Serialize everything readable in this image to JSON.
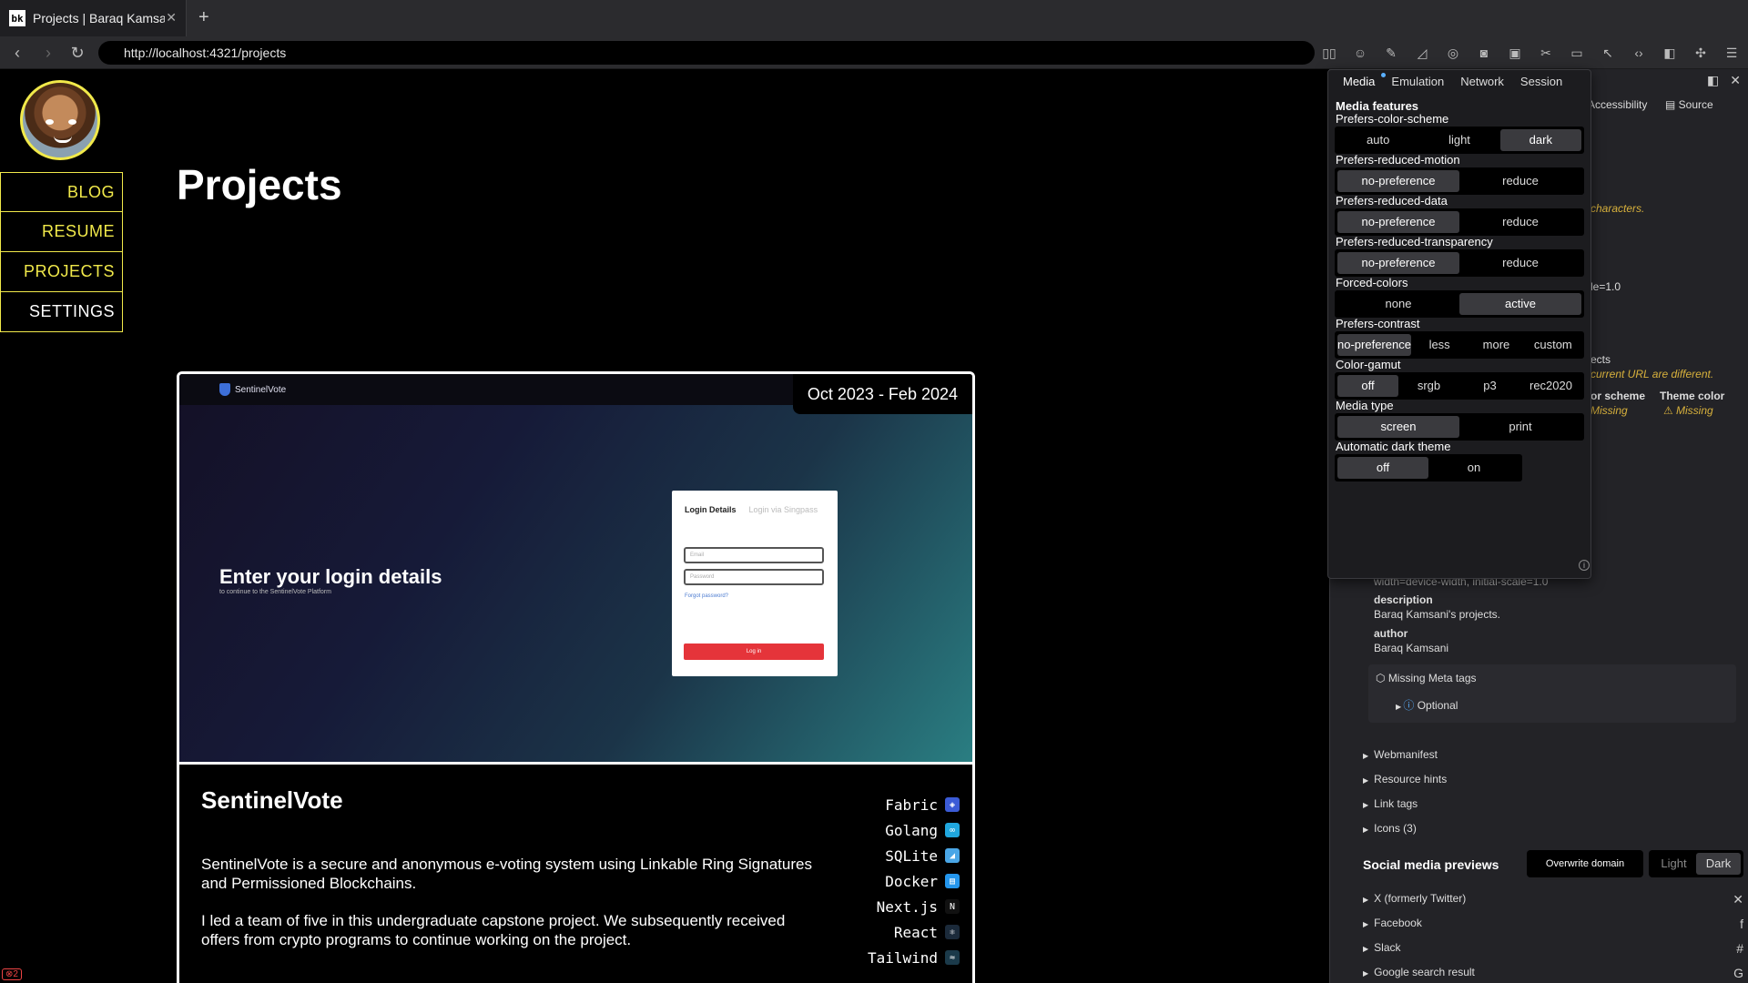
{
  "browser": {
    "tab_title": "Projects | Baraq Kamsani",
    "tab_close": "✕",
    "new_tab": "+",
    "url": "http://localhost:4321/projects"
  },
  "site": {
    "nav": [
      "BLOG",
      "RESUME",
      "PROJECTS",
      "SETTINGS"
    ],
    "page_title": "Projects",
    "project": {
      "date_range": "Oct 2023 - Feb 2024",
      "title": "SentinelVote",
      "desc_1": "SentinelVote is a secure and anonymous e-voting system using Linkable Ring Signatures and Permissioned Blockchains.",
      "desc_2": "I led a team of five in this undergraduate capstone project. We subsequently received offers from crypto programs to continue working on the project.",
      "screenshot": {
        "logo": "SentinelVote",
        "heading": "Enter your login details",
        "subheading": "to continue to the SentinelVote Platform",
        "tab_active": "Login Details",
        "tab_inactive": "Login via Singpass",
        "email_placeholder": "Email",
        "password_placeholder": "Password",
        "forgot": "Forgot password?",
        "login_button": "Log in"
      },
      "stack": [
        {
          "name": "Fabric",
          "icon": "fabric-icon",
          "color": "#3b5bd6",
          "glyph": "◈"
        },
        {
          "name": "Golang",
          "icon": "golang-icon",
          "color": "#20a7de",
          "glyph": "∞"
        },
        {
          "name": "SQLite",
          "icon": "sqlite-icon",
          "color": "#4aa6e6",
          "glyph": "◢"
        },
        {
          "name": "Docker",
          "icon": "docker-icon",
          "color": "#2496ed",
          "glyph": "▤"
        },
        {
          "name": "Next.js",
          "icon": "nextjs-icon",
          "color": "#111111",
          "glyph": "N"
        },
        {
          "name": "React",
          "icon": "react-icon",
          "color": "#1b2a3a",
          "glyph": "⚛"
        },
        {
          "name": "Tailwind",
          "icon": "tailwind-icon",
          "color": "#1b3a4a",
          "glyph": "≈"
        }
      ]
    }
  },
  "popover": {
    "tabs": [
      "Media",
      "Emulation",
      "Network",
      "Session"
    ],
    "title": "Media features",
    "features": [
      {
        "label": "Prefers-color-scheme",
        "options": [
          "auto",
          "light",
          "dark"
        ],
        "selected": 2
      },
      {
        "label": "Prefers-reduced-motion",
        "options": [
          "no-preference",
          "reduce"
        ],
        "selected": 0
      },
      {
        "label": "Prefers-reduced-data",
        "options": [
          "no-preference",
          "reduce"
        ],
        "selected": 0
      },
      {
        "label": "Prefers-reduced-transparency",
        "options": [
          "no-preference",
          "reduce"
        ],
        "selected": 0
      },
      {
        "label": "Forced-colors",
        "options": [
          "none",
          "active"
        ],
        "selected": 1
      },
      {
        "label": "Prefers-contrast",
        "options": [
          "no-preference",
          "less",
          "more",
          "custom"
        ],
        "selected": 0
      },
      {
        "label": "Color-gamut",
        "options": [
          "off",
          "srgb",
          "p3",
          "rec2020"
        ],
        "selected": 0
      },
      {
        "label": "Media type",
        "options": [
          "screen",
          "print"
        ],
        "selected": 0
      },
      {
        "label": "Automatic dark theme",
        "options": [
          "off",
          "on"
        ],
        "selected": 0
      }
    ]
  },
  "devpanel": {
    "tab_accessibility": "Accessibility",
    "tab_source": "Source",
    "frag_characters": "characters.",
    "frag_scale": "le=1.0",
    "frag_ects": "ects",
    "frag_url_diff": "current URL are different.",
    "frag_color_scheme": "or scheme",
    "frag_missing_1": "Missing",
    "theme_color": "Theme color",
    "frag_missing_2": "⚠ Missing",
    "viewport_value": "width=device-width, initial-scale=1.0",
    "meta_description_key": "description",
    "meta_description_val": "Baraq Kamsani's projects.",
    "meta_author_key": "author",
    "meta_author_val": "Baraq Kamsani",
    "missing_meta_tags": "Missing Meta tags",
    "optional": "Optional",
    "tree": [
      "Webmanifest",
      "Resource hints",
      "Link tags",
      "Icons (3)"
    ],
    "social_title": "Social media previews",
    "overwrite_domain": "Overwrite domain",
    "light": "Light",
    "dark": "Dark",
    "social": [
      {
        "name": "X (formerly Twitter)",
        "icon": "x-icon",
        "glyph": "✕"
      },
      {
        "name": "Facebook",
        "icon": "facebook-icon",
        "glyph": "f"
      },
      {
        "name": "Slack",
        "icon": "slack-icon",
        "glyph": "#"
      },
      {
        "name": "Google search result",
        "icon": "google-icon",
        "glyph": "G"
      }
    ]
  },
  "status": {
    "errors": "⊗2"
  }
}
